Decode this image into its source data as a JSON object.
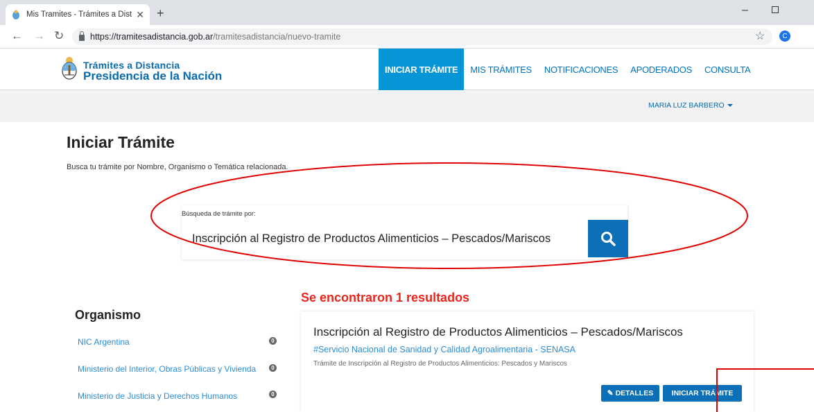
{
  "browser": {
    "tab_title": "Mis Tramites - Trámites a Distanc",
    "url_host": "https://tramitesadistancia.gob.ar",
    "url_path": "/tramitesadistancia/nuevo-tramite",
    "profile_initial": "C"
  },
  "header": {
    "logo_line1": "Trámites a Distancia",
    "logo_line2": "Presidencia de la Nación",
    "nav": [
      {
        "label": "INICIAR TRÁMITE",
        "active": true
      },
      {
        "label": "MIS TRÁMITES"
      },
      {
        "label": "NOTIFICACIONES"
      },
      {
        "label": "APODERADOS"
      },
      {
        "label": "CONSULTA"
      }
    ],
    "user_name": "MARIA LUZ BARBERO"
  },
  "page": {
    "title": "Iniciar Trámite",
    "subtitle": "Busca tu trámite por Nombre, Organismo o Temática relacionada.",
    "search_label": "Búsqueda de trámite por:",
    "search_value": "Inscripción al Registro de Productos Alimenticios – Pescados/Mariscos",
    "result_count": "Se encontraron 1 resultados"
  },
  "sidebar": {
    "title": "Organismo",
    "items": [
      {
        "label": "NIC Argentina",
        "count": "0"
      },
      {
        "label": "Ministerio del Interior, Obras Públicas y Vivienda",
        "count": "0"
      },
      {
        "label": "Ministerio de Justicia y Derechos Humanos",
        "count": "0"
      }
    ]
  },
  "result": {
    "title": "Inscripción al Registro de Productos Alimenticios – Pescados/Mariscos",
    "organism": "#Servicio Nacional de Sanidad y Calidad Agroalimentaria - SENASA",
    "description": "Trámite de Inscripción al Registro de Productos Alimenticios: Pescados y Mariscos",
    "details_label": "DETALLES",
    "start_label": "INICIAR TRÁMITE"
  },
  "colors": {
    "brand_blue": "#0b70b8",
    "nav_active": "#0695d6",
    "link_blue": "#2d8cd6",
    "alert_red": "#e8261c",
    "annotation_red": "#e00000"
  }
}
